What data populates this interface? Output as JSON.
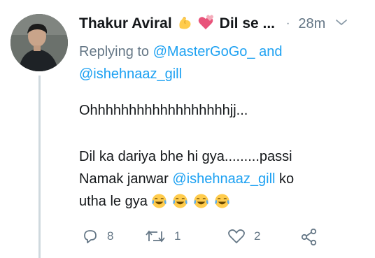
{
  "tweet": {
    "author_name": "Thakur Aviral",
    "author_name_suffix": "Dil se ...",
    "separator": "·",
    "timestamp": "28m",
    "replying_prefix": "Replying to",
    "replying_user1": "@MasterGoGo_",
    "replying_and": "and",
    "replying_user2": "@ishehnaaz_gill",
    "text_line1": "Ohhhhhhhhhhhhhhhhhhjj...",
    "text_line2": "Dil ka dariya bhe hi gya.........passi",
    "text_line3_prefix": "Namak janwar",
    "text_mention": "@ishehnaaz_gill",
    "text_line3_suffix": "ko",
    "text_line4": "utha le gya"
  },
  "actions": {
    "reply_count": "8",
    "retweet_count": "1",
    "like_count": "2"
  },
  "colors": {
    "link": "#1da1f2",
    "secondary": "#657786",
    "thread_line": "#cfd9de"
  },
  "icons": [
    "flexed-biceps-emoji",
    "revolving-hearts-emoji",
    "chevron-down-icon",
    "crying-laughing-emoji",
    "reply-icon",
    "retweet-icon",
    "like-icon",
    "share-icon"
  ]
}
